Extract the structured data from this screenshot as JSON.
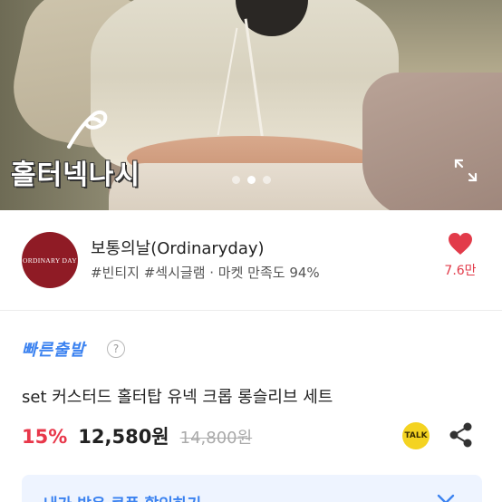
{
  "hero": {
    "caption": "홀터넥나시",
    "dots": 3,
    "active_dot": 1,
    "expand_icon": "expand-icon"
  },
  "shop": {
    "logo_text": "ORDINARY DAY",
    "name": "보통의날(Ordinaryday)",
    "tags": "#빈티지 #섹시글램 · 마켓 만족도 94%",
    "like_count": "7.6만",
    "heart_color": "#e23b4a"
  },
  "product": {
    "fast_ship_label": "빠른출발",
    "help_symbol": "?",
    "title": "set 커스터드 홀터탑 유넥 크롭 롱슬리브 세트",
    "discount": "15%",
    "price": "12,580원",
    "original_price": "14,800원",
    "talk_label": "TALK"
  },
  "coupon": {
    "text": "내가 받은 쿠폰 할인하기"
  },
  "colors": {
    "accent_blue": "#3b82f0",
    "discount_red": "#e8374a",
    "logo_bg": "#8f1b25",
    "kakao_yellow": "#f4d321"
  }
}
